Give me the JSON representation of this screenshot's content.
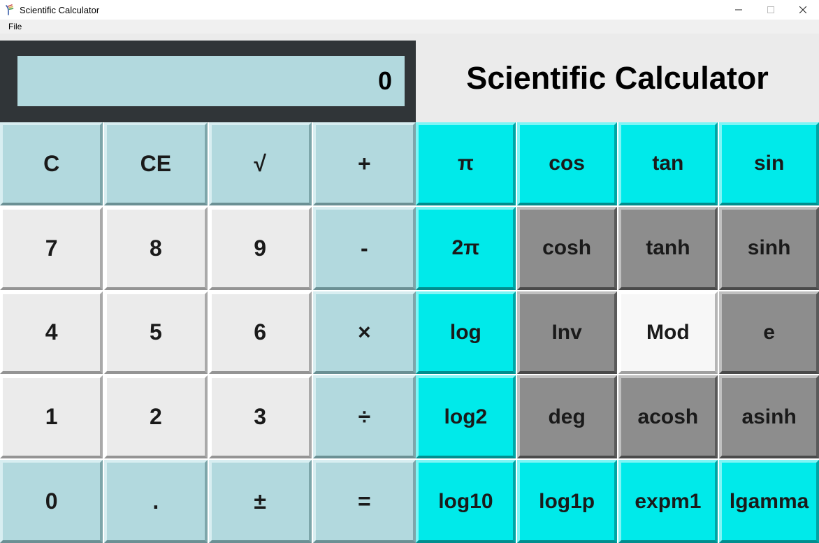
{
  "window": {
    "title": "Scientific Calculator"
  },
  "menu": {
    "file": "File"
  },
  "display": {
    "value": "0"
  },
  "heading": "Scientific Calculator",
  "buttons": {
    "left": [
      [
        {
          "label": "C",
          "cls": "powder",
          "name": "clear-button"
        },
        {
          "label": "CE",
          "cls": "powder",
          "name": "clear-entry-button"
        },
        {
          "label": "√",
          "cls": "powder",
          "name": "sqrt-button"
        },
        {
          "label": "+",
          "cls": "powder",
          "name": "plus-button"
        }
      ],
      [
        {
          "label": "7",
          "cls": "lightgray",
          "name": "digit-7-button"
        },
        {
          "label": "8",
          "cls": "lightgray",
          "name": "digit-8-button"
        },
        {
          "label": "9",
          "cls": "lightgray",
          "name": "digit-9-button"
        },
        {
          "label": "-",
          "cls": "powder",
          "name": "minus-button"
        }
      ],
      [
        {
          "label": "4",
          "cls": "lightgray",
          "name": "digit-4-button"
        },
        {
          "label": "5",
          "cls": "lightgray",
          "name": "digit-5-button"
        },
        {
          "label": "6",
          "cls": "lightgray",
          "name": "digit-6-button"
        },
        {
          "label": "×",
          "cls": "powder",
          "name": "multiply-button"
        }
      ],
      [
        {
          "label": "1",
          "cls": "lightgray",
          "name": "digit-1-button"
        },
        {
          "label": "2",
          "cls": "lightgray",
          "name": "digit-2-button"
        },
        {
          "label": "3",
          "cls": "lightgray",
          "name": "digit-3-button"
        },
        {
          "label": "÷",
          "cls": "powder",
          "name": "divide-button"
        }
      ],
      [
        {
          "label": "0",
          "cls": "powder",
          "name": "digit-0-button"
        },
        {
          "label": ".",
          "cls": "powder",
          "name": "decimal-button"
        },
        {
          "label": "±",
          "cls": "powder",
          "name": "plus-minus-button"
        },
        {
          "label": "=",
          "cls": "powder",
          "name": "equals-button"
        }
      ]
    ],
    "right": [
      [
        {
          "label": "π",
          "cls": "cyan",
          "name": "pi-button"
        },
        {
          "label": "cos",
          "cls": "cyan",
          "name": "cos-button"
        },
        {
          "label": "tan",
          "cls": "cyan",
          "name": "tan-button"
        },
        {
          "label": "sin",
          "cls": "cyan",
          "name": "sin-button"
        }
      ],
      [
        {
          "label": "2π",
          "cls": "cyan",
          "name": "two-pi-button"
        },
        {
          "label": "cosh",
          "cls": "gray",
          "name": "cosh-button"
        },
        {
          "label": "tanh",
          "cls": "gray",
          "name": "tanh-button"
        },
        {
          "label": "sinh",
          "cls": "gray",
          "name": "sinh-button"
        }
      ],
      [
        {
          "label": "log",
          "cls": "cyan",
          "name": "log-button"
        },
        {
          "label": "Inv",
          "cls": "gray",
          "name": "inv-button"
        },
        {
          "label": "Mod",
          "cls": "white",
          "name": "mod-button"
        },
        {
          "label": "e",
          "cls": "gray",
          "name": "e-button"
        }
      ],
      [
        {
          "label": "log2",
          "cls": "cyan",
          "name": "log2-button"
        },
        {
          "label": "deg",
          "cls": "gray",
          "name": "deg-button"
        },
        {
          "label": "acosh",
          "cls": "gray",
          "name": "acosh-button"
        },
        {
          "label": "asinh",
          "cls": "gray",
          "name": "asinh-button"
        }
      ],
      [
        {
          "label": "log10",
          "cls": "cyan",
          "name": "log10-button"
        },
        {
          "label": "log1p",
          "cls": "cyan",
          "name": "log1p-button"
        },
        {
          "label": "expm1",
          "cls": "cyan",
          "name": "expm1-button"
        },
        {
          "label": "lgamma",
          "cls": "cyan",
          "name": "lgamma-button"
        }
      ]
    ]
  }
}
